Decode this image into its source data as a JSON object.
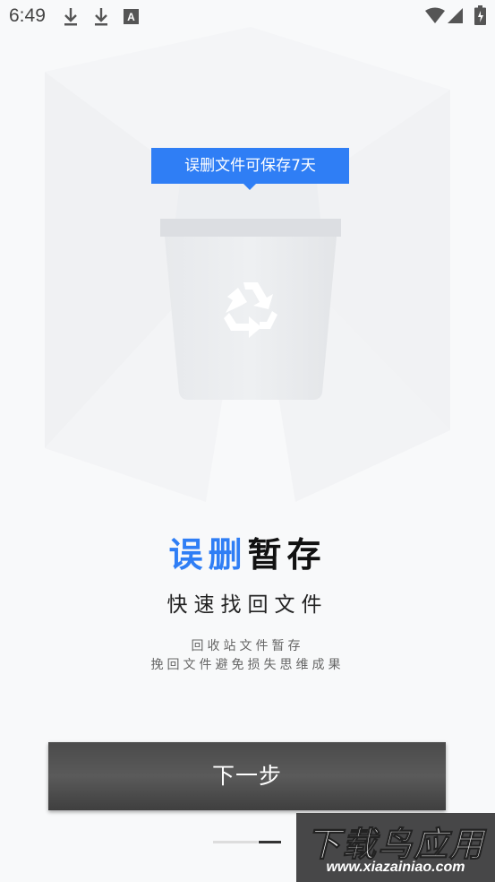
{
  "status_bar": {
    "time": "6:49",
    "left_icons": [
      "download-icon",
      "download-icon",
      "font-a-icon"
    ],
    "right_icons": [
      "wifi-icon",
      "signal-icon",
      "battery-icon"
    ]
  },
  "illustration": {
    "tooltip": "误删文件可保存7天",
    "icon": "recycle-icon"
  },
  "content": {
    "title_highlight": "误删",
    "title_rest": "暂存",
    "subtitle": "快速找回文件",
    "desc_line1": "回收站文件暂存",
    "desc_line2": "挽回文件避免损失思维成果"
  },
  "next_button": {
    "label": "下一步"
  },
  "pager": {
    "total": 2,
    "current": 2
  },
  "watermark": {
    "title": "下载鸟应用",
    "url": "www.xiazainiao.com"
  },
  "colors": {
    "accent": "#2f7ef5",
    "button": "#4a4a4a",
    "background": "#f8f9fa"
  }
}
